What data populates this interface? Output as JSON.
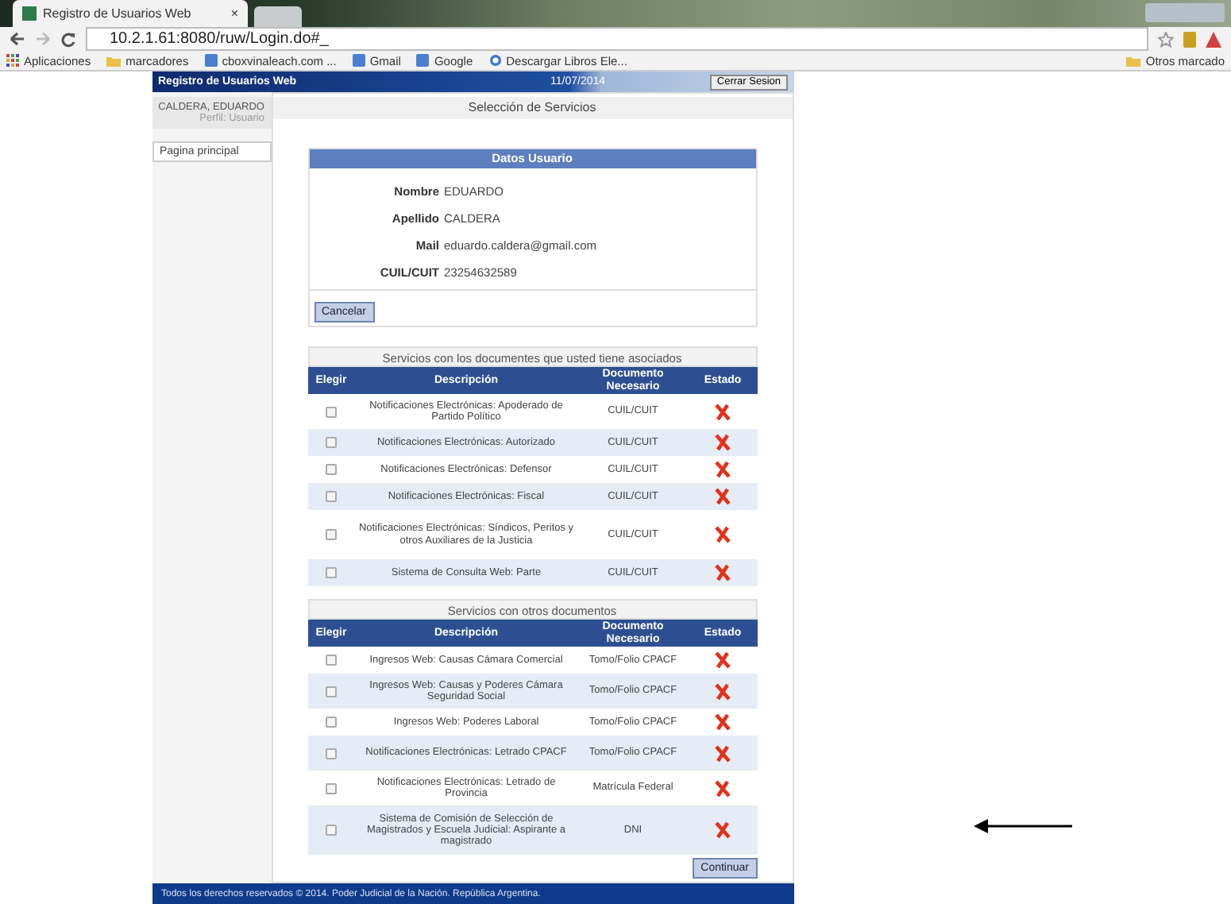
{
  "browser": {
    "tab_title": "Registro de Usuarios Web",
    "tab_close": "×",
    "url": "10.2.1.61:8080/ruw/Login.do#_",
    "bookmarks": [
      {
        "label": "Aplicaciones",
        "kind": "apps"
      },
      {
        "label": "marcadores",
        "kind": "folder"
      },
      {
        "label": "cboxvinaleach.com ...",
        "kind": "page"
      },
      {
        "label": "Gmail",
        "kind": "page"
      },
      {
        "label": "Google",
        "kind": "page"
      },
      {
        "label": "Descargar Libros Ele...",
        "kind": "globe"
      }
    ],
    "other_bookmarks": "Otros marcado"
  },
  "header": {
    "title": "Registro de Usuarios Web",
    "date": "11/07/2014",
    "logout": "Cerrar Sesion"
  },
  "sidebar": {
    "user_name": "CALDERA, EDUARDO",
    "profile": "Perfil: Usuario",
    "menu_items": [
      {
        "label": "Pagina principal",
        "selected": false
      }
    ]
  },
  "main": {
    "title": "Selección de Servicios",
    "user_card": {
      "title": "Datos Usuario",
      "fields": [
        {
          "label": "Nombre",
          "value": "EDUARDO"
        },
        {
          "label": "Apellido",
          "value": "CALDERA"
        },
        {
          "label": "Mail",
          "value": "eduardo.caldera@gmail.com"
        },
        {
          "label": "CUIL/CUIT",
          "value": "23254632589"
        }
      ],
      "cancel": "Cancelar"
    },
    "tables": [
      {
        "title": "Servicios con los documentes que usted tiene asociados",
        "columns": [
          "Elegir",
          "Descripción",
          "Documento Necesario",
          "Estado"
        ],
        "rows": [
          {
            "checked": false,
            "description": "Notificaciones Electrónicas: Apoderado de Partido Político",
            "document": "CUIL/CUIT",
            "valid": false
          },
          {
            "checked": false,
            "description": "Notificaciones Electrónicas: Autorizado",
            "document": "CUIL/CUIT",
            "valid": false
          },
          {
            "checked": false,
            "description": "Notificaciones Electrónicas: Defensor",
            "document": "CUIL/CUIT",
            "valid": false
          },
          {
            "checked": false,
            "description": "Notificaciones Electrónicas: Fiscal",
            "document": "CUIL/CUIT",
            "valid": false
          },
          {
            "checked": false,
            "description": "Notificaciones Electrónicas: Síndicos, Peritos y otros Auxiliares de la Justicia",
            "document": "CUIL/CUIT",
            "valid": false
          },
          {
            "checked": false,
            "description": "Sistema de Consulta Web: Parte",
            "document": "CUIL/CUIT",
            "valid": false
          }
        ]
      },
      {
        "title": "Servicios con otros documentos",
        "columns": [
          "Elegir",
          "Descripción",
          "Documento Necesario",
          "Estado"
        ],
        "rows": [
          {
            "checked": false,
            "description": "Ingresos Web: Causas Cámara Comercial",
            "document": "Tomo/Folio CPACF",
            "valid": false
          },
          {
            "checked": false,
            "description": "Ingresos Web: Causas y Poderes Cámara Seguridad Social",
            "document": "Tomo/Folio CPACF",
            "valid": false
          },
          {
            "checked": false,
            "description": "Ingresos Web: Poderes Laboral",
            "document": "Tomo/Folio CPACF",
            "valid": false
          },
          {
            "checked": false,
            "description": "Notificaciones Electrónicas: Letrado CPACF",
            "document": "Tomo/Folio CPACF",
            "valid": false
          },
          {
            "checked": false,
            "description": "Notificaciones Electrónicas: Letrado de Provincia",
            "document": "Matrícula Federal",
            "valid": false
          },
          {
            "checked": false,
            "description": "Sistema de Comisión de Selección de Magistrados y Escuela Judicial: Aspirante a magistrado",
            "document": "DNI",
            "valid": false
          }
        ]
      }
    ],
    "continue": "Continuar"
  },
  "footer": "Todos los derechos reservados © 2014. Poder Judicial de la Nación. República Argentina."
}
